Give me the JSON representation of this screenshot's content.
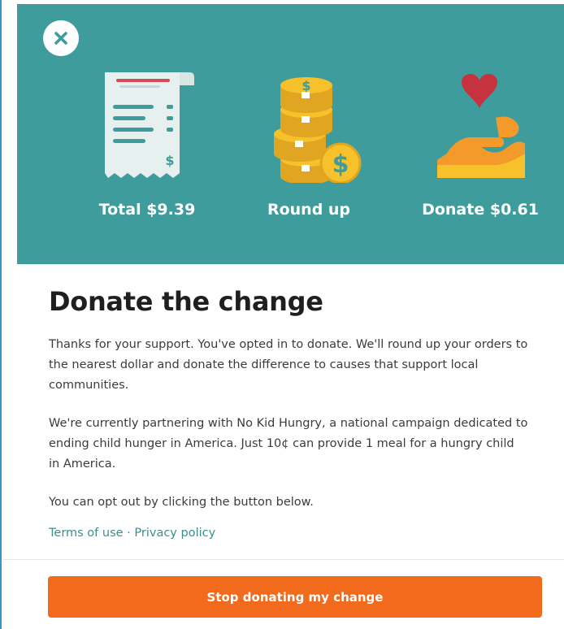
{
  "hero": {
    "steps": [
      {
        "label": "Total $9.39",
        "icon": "receipt-icon"
      },
      {
        "label": "Round up",
        "icon": "coins-icon"
      },
      {
        "label": "Donate $0.61",
        "icon": "heart-hand-icon"
      }
    ]
  },
  "close_icon": "close-icon",
  "content": {
    "title": "Donate the change",
    "paragraph1": "Thanks for your support. You've opted in to donate. We'll round up your orders to the nearest dollar and donate the difference to causes that support local communities.",
    "paragraph2": "We're currently partnering with No Kid Hungry, a national campaign dedicated to ending child hunger in America. Just 10¢ can provide 1 meal for a hungry child in America.",
    "paragraph3": "You can opt out by clicking the button below."
  },
  "links": {
    "terms": "Terms of use",
    "separator": " · ",
    "privacy": "Privacy policy"
  },
  "button": {
    "label": "Stop donating my change"
  },
  "colors": {
    "hero_bg": "#3f9c9c",
    "accent_orange": "#f26b1d",
    "link_teal": "#3a8f8c",
    "coin_yellow": "#f7c12b",
    "heart_red": "#c6323d"
  }
}
